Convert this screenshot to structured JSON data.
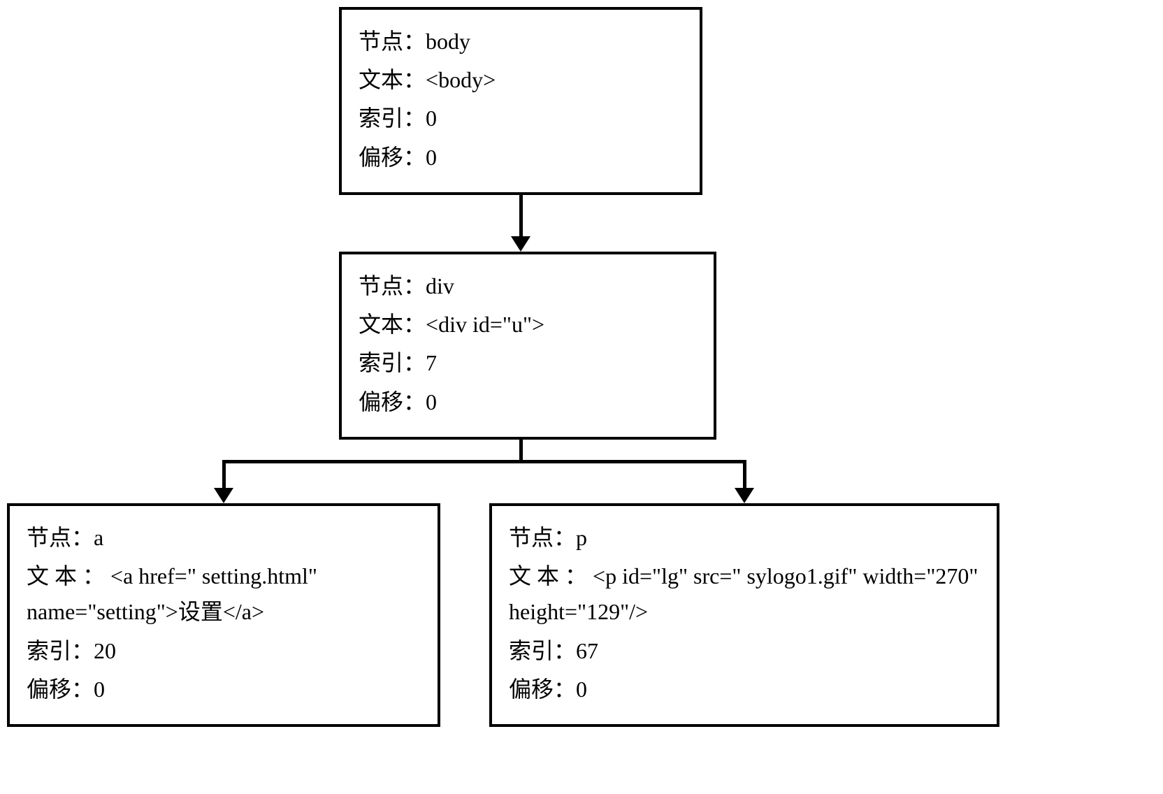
{
  "labels": {
    "node": "节点：",
    "text": "文本：",
    "text_spaced": "文 本 ：",
    "index": "索引：",
    "offset": "偏移："
  },
  "nodes": {
    "n1": {
      "node": "body",
      "text": "<body>",
      "index": "0",
      "offset": "0"
    },
    "n2": {
      "node": "div",
      "text": "<div id=\"u\">",
      "index": "7",
      "offset": "0"
    },
    "n3": {
      "node": "a",
      "text": "<a href=\" setting.html\" name=\"setting\">设置</a>",
      "index": "20",
      "offset": "0"
    },
    "n4": {
      "node": "p",
      "text": "<p id=\"lg\" src=\" sylogo1.gif\" width=\"270\" height=\"129\"/>",
      "index": "67",
      "offset": "0"
    }
  }
}
